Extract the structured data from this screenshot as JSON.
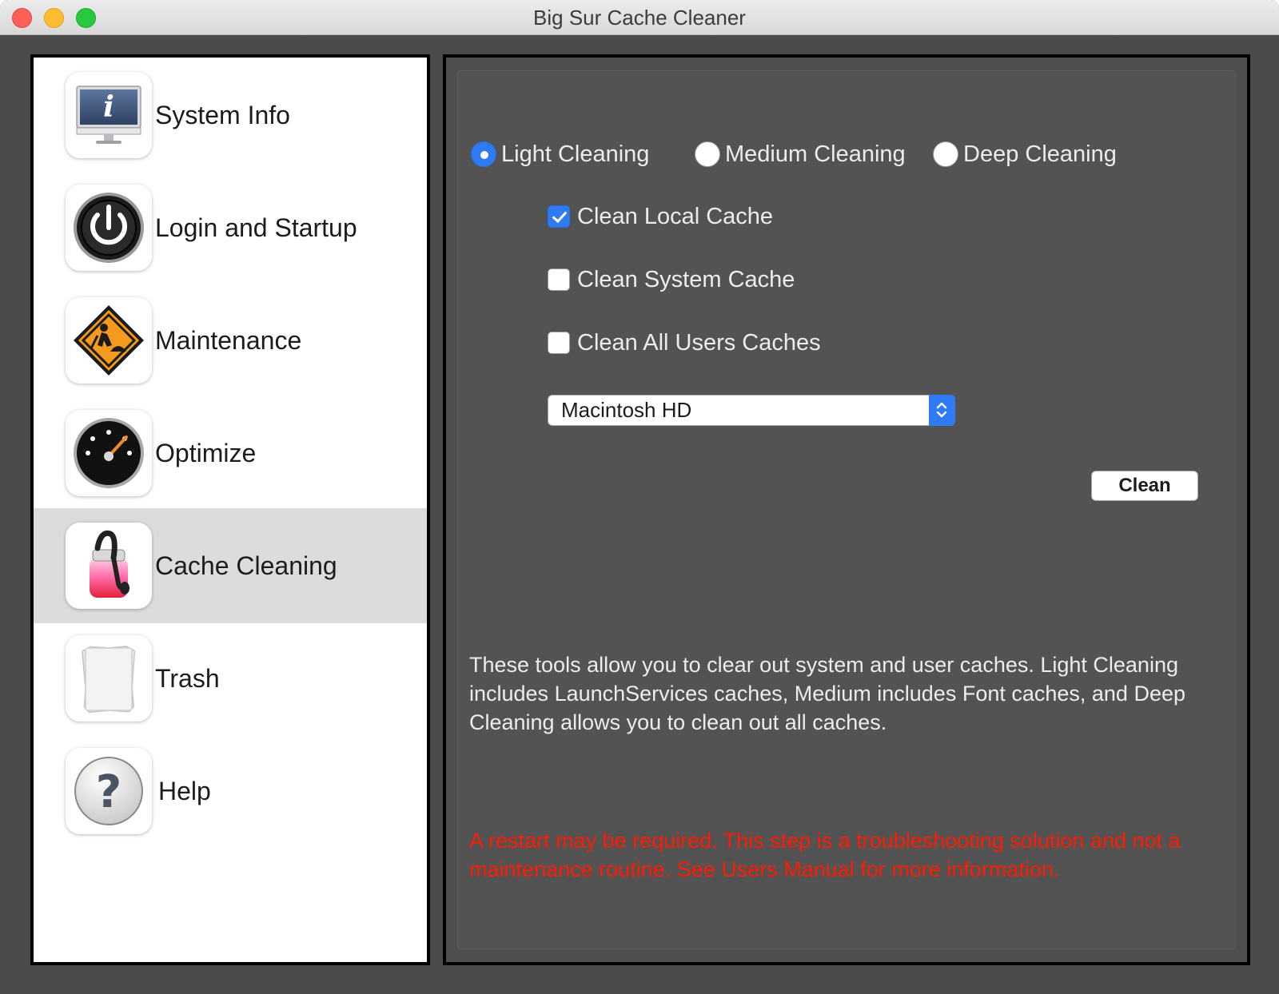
{
  "window": {
    "title": "Big Sur Cache Cleaner"
  },
  "sidebar": {
    "items": [
      {
        "label": "System Info",
        "icon": "system-info-icon"
      },
      {
        "label": "Login and Startup",
        "icon": "power-icon"
      },
      {
        "label": "Maintenance",
        "icon": "construction-sign-icon"
      },
      {
        "label": "Optimize",
        "icon": "speedometer-icon"
      },
      {
        "label": "Cache Cleaning",
        "icon": "cache-cleaning-icon",
        "selected": true
      },
      {
        "label": "Trash",
        "icon": "trash-icon"
      },
      {
        "label": "Help",
        "icon": "help-icon"
      }
    ]
  },
  "main": {
    "cleaning_levels": [
      {
        "label": "Light Cleaning",
        "selected": true
      },
      {
        "label": "Medium Cleaning",
        "selected": false
      },
      {
        "label": "Deep Cleaning",
        "selected": false
      }
    ],
    "options": [
      {
        "label": "Clean Local Cache",
        "checked": true
      },
      {
        "label": "Clean System Cache",
        "checked": false
      },
      {
        "label": "Clean All Users Caches",
        "checked": false
      }
    ],
    "volume_select": {
      "value": "Macintosh HD"
    },
    "clean_button": "Clean",
    "description": "These tools allow you to clear out system and user caches.  Light Cleaning includes LaunchServices caches, Medium includes Font caches, and Deep Cleaning allows you to clean out all caches.",
    "warning": "A restart may be required.  This step is a troubleshooting solution and not a maintenance routine.  See Users Manual for more information."
  },
  "colors": {
    "accent": "#2f7bf5",
    "warning": "#ff1a00",
    "panel": "#535353",
    "sidebar_selected": "#dcdcdc"
  }
}
